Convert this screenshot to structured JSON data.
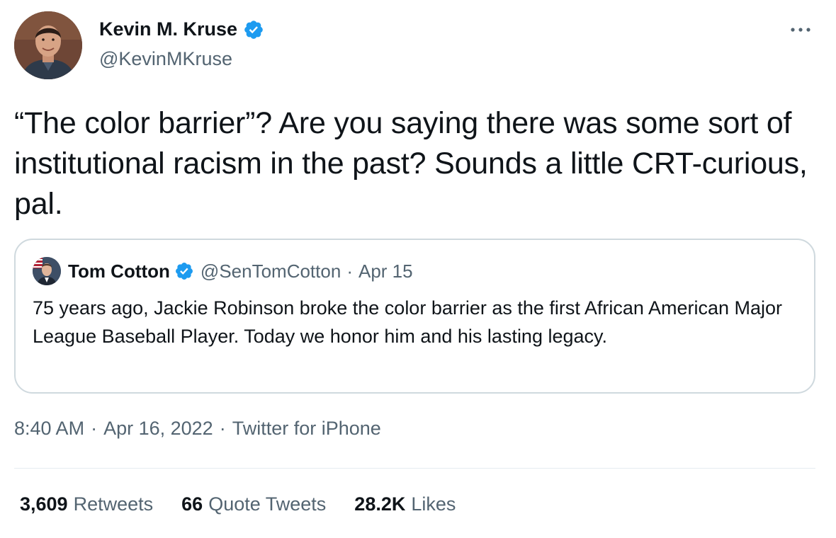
{
  "colors": {
    "text_primary": "#0f1419",
    "text_secondary": "#536471",
    "verified_blue": "#1d9bf0",
    "border": "#cfd9de"
  },
  "author": {
    "name": "Kevin M. Kruse",
    "handle": "@KevinMKruse",
    "verified_icon": "verified-badge-icon",
    "avatar_icon": "profile-photo"
  },
  "more_icon": "more-options-icon",
  "tweet": {
    "text": "“The color barrier”? Are you saying there was some sort of institutional racism in the past? Sounds a little CRT-curious, pal."
  },
  "quoted_tweet": {
    "name": "Tom Cotton",
    "handle": "@SenTomCotton",
    "separator": "·",
    "date": "Apr 15",
    "text": "75 years ago, Jackie Robinson broke the color barrier as the first African American Major League Baseball Player. Today we honor him and his lasting legacy."
  },
  "meta": {
    "time": "8:40 AM",
    "separator": "·",
    "date": "Apr 16, 2022",
    "source": "Twitter for iPhone"
  },
  "stats": [
    {
      "value": "3,609",
      "label": "Retweets"
    },
    {
      "value": "66",
      "label": "Quote Tweets"
    },
    {
      "value": "28.2K",
      "label": "Likes"
    }
  ]
}
